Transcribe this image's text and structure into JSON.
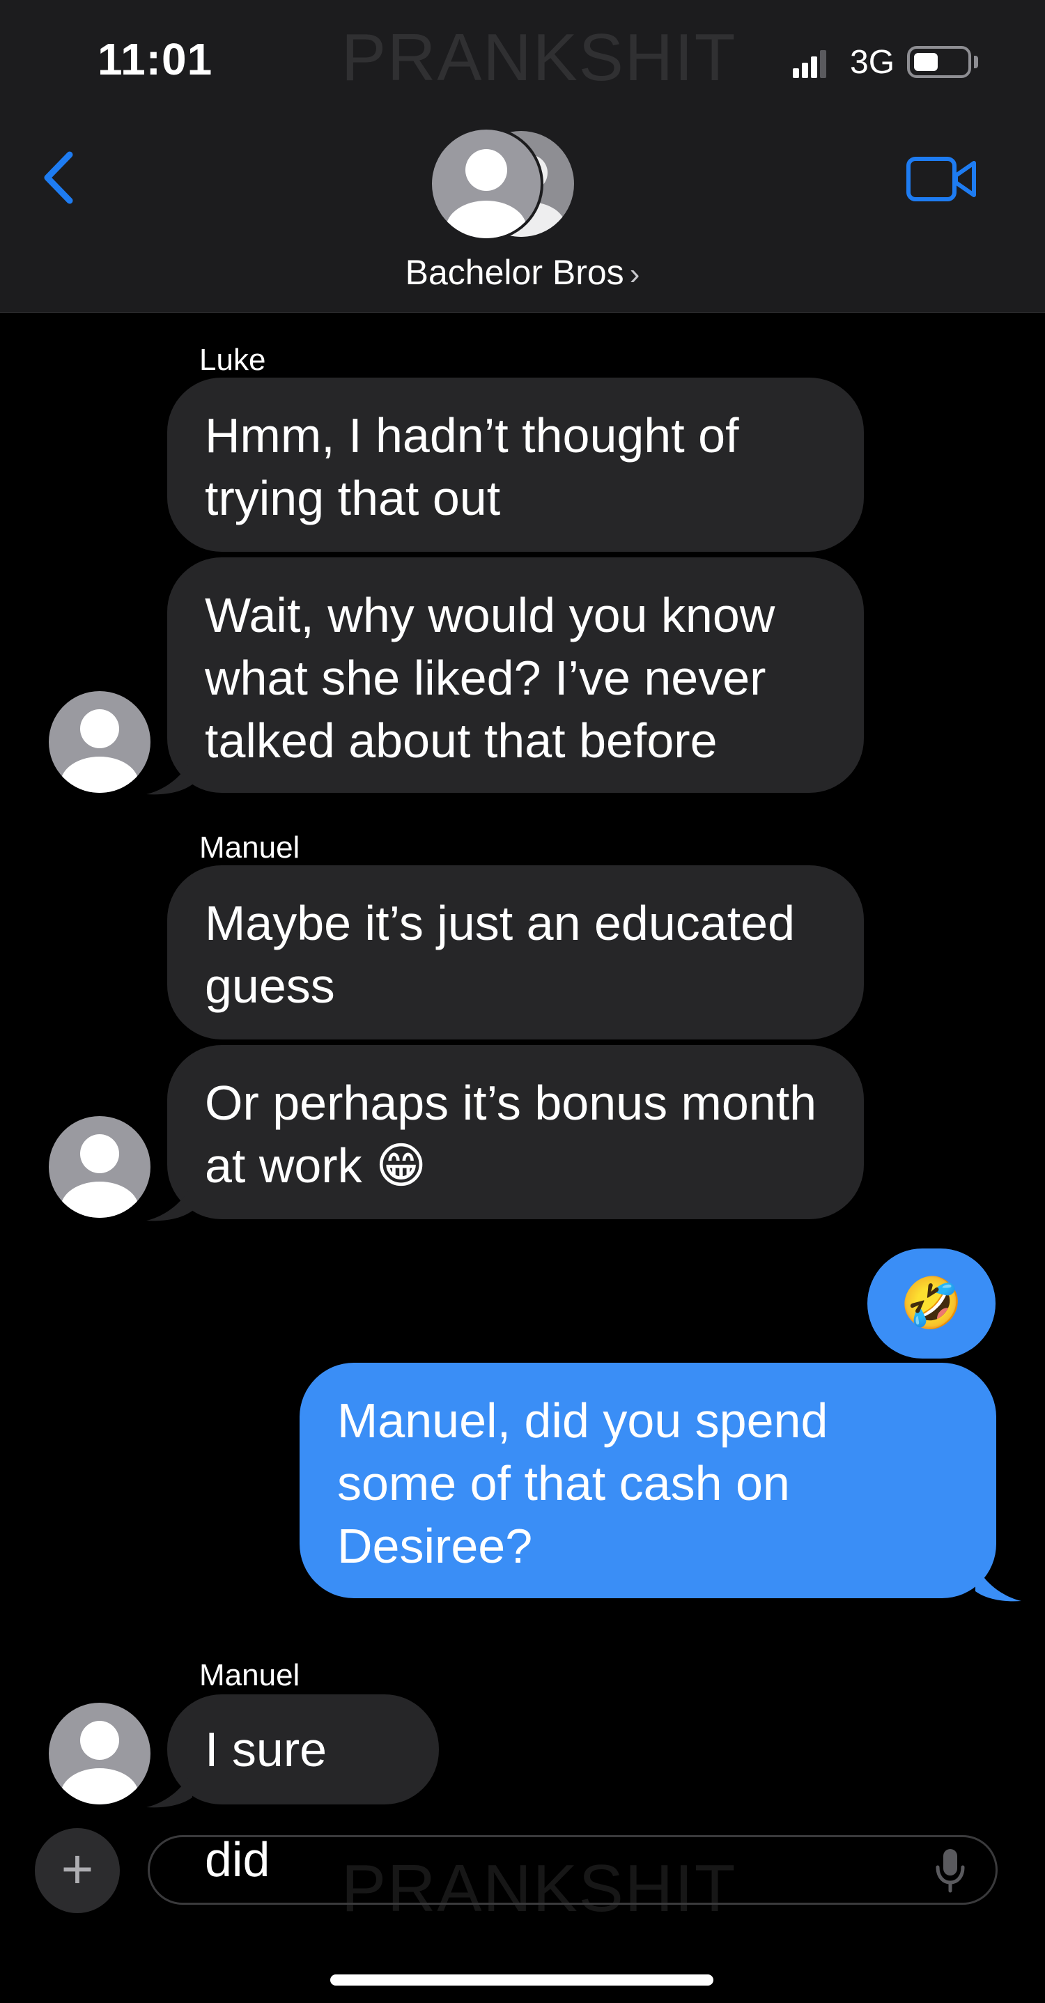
{
  "status_bar": {
    "time": "11:01",
    "network": "3G"
  },
  "header": {
    "group_name": "Bachelor Bros",
    "chevron": "›"
  },
  "watermark": "PRANKSHIT",
  "messages": [
    {
      "sender": "Luke",
      "lines": [
        "Hmm, I hadn’t thought of",
        "trying that out"
      ]
    },
    {
      "lines": [
        "Wait, why would you know",
        "what she liked? I’ve never",
        "talked about that before"
      ]
    },
    {
      "sender": "Manuel",
      "lines": [
        "Maybe it’s just an educated",
        "guess"
      ]
    },
    {
      "lines": [
        "Or perhaps it’s bonus month",
        "at work 😁"
      ]
    },
    {
      "emoji": "🤣"
    },
    {
      "lines": [
        "Manuel, did you spend",
        "some of that cash on",
        "Desiree?"
      ]
    },
    {
      "sender": "Manuel",
      "lines": [
        "I sure did"
      ]
    }
  ],
  "input": {
    "placeholder": ""
  },
  "colors": {
    "incoming_bubble": "#262628",
    "outgoing_bubble": "#3a8ef6",
    "accent": "#1e7cf2",
    "header_bg": "#1c1c1e"
  },
  "icons": [
    "back-chevron-icon",
    "video-camera-icon",
    "group-avatar-icon",
    "signal-icon",
    "battery-icon",
    "avatar-icon",
    "plus-icon",
    "microphone-icon"
  ]
}
